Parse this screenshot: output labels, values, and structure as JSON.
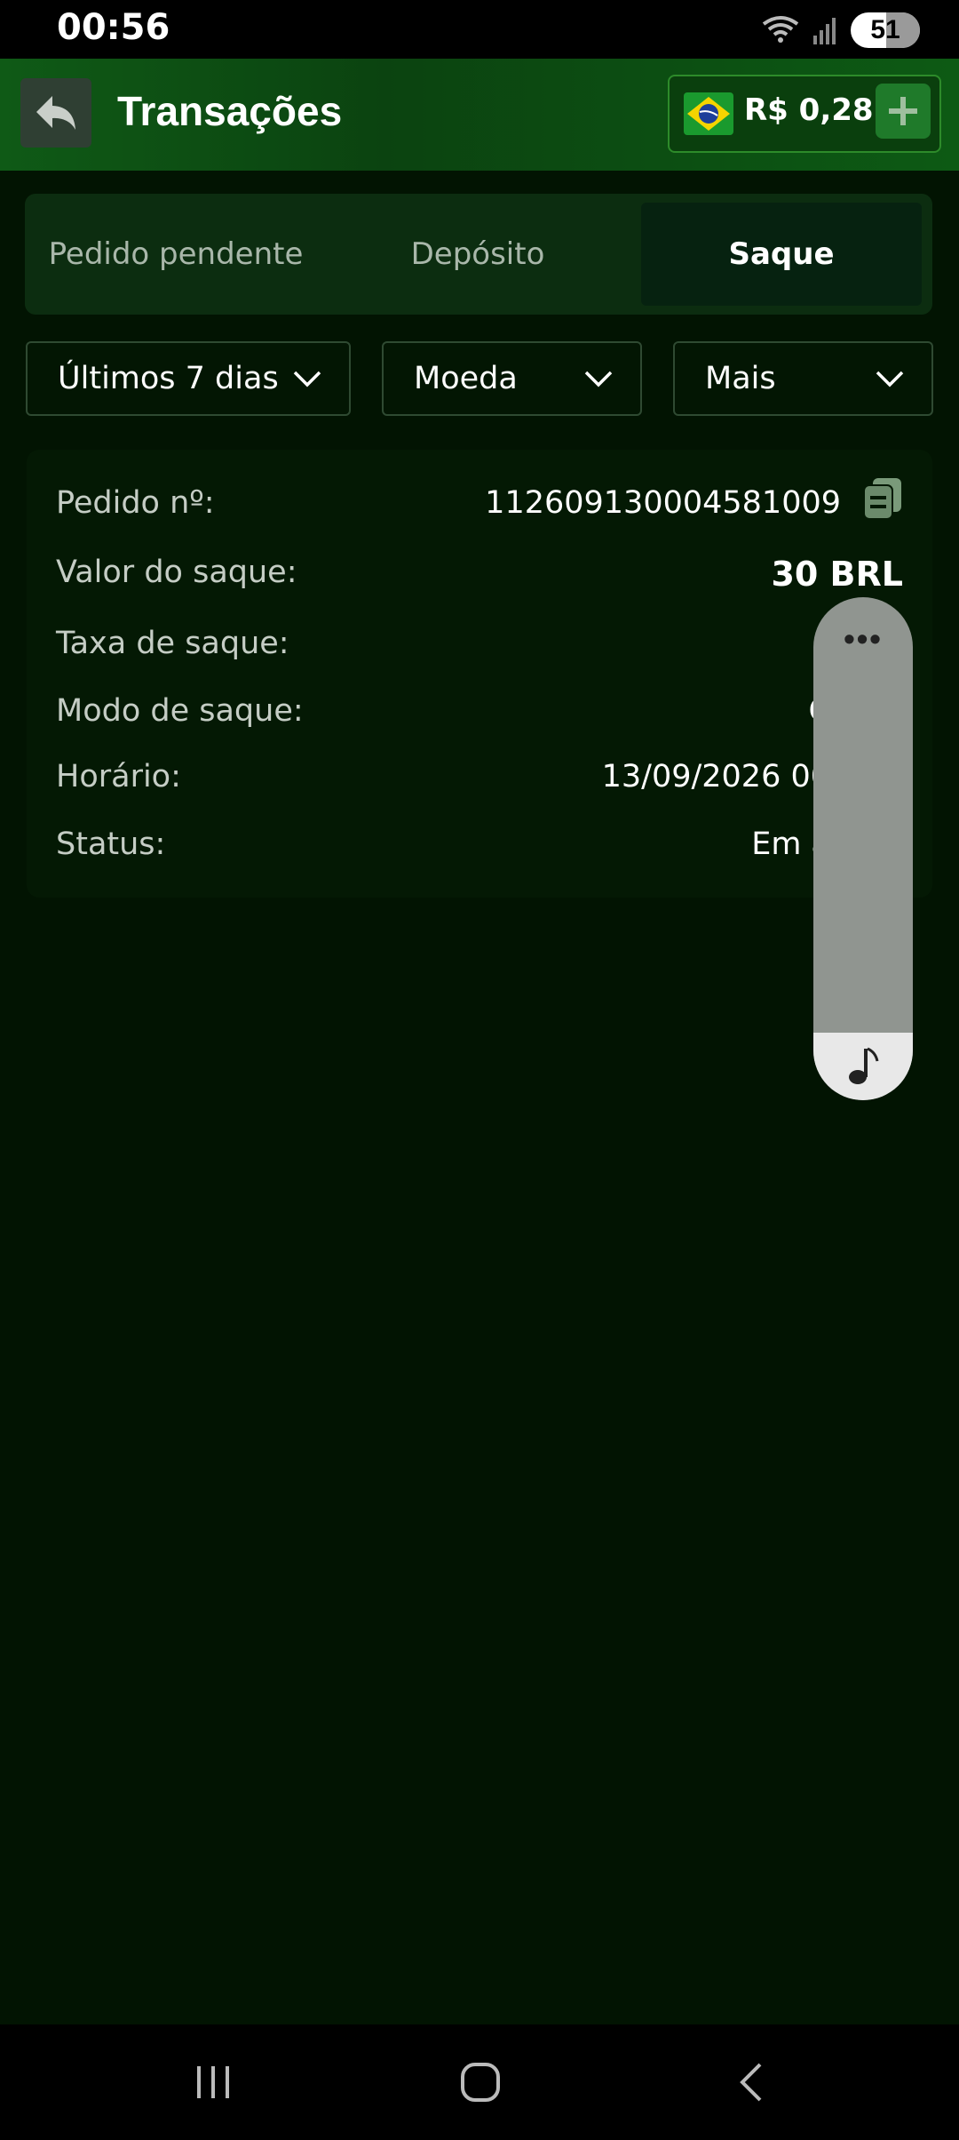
{
  "status_bar": {
    "time": "00:56",
    "battery": "51"
  },
  "header": {
    "title": "Transações",
    "balance": "R$ 0,28"
  },
  "tabs": [
    {
      "label": "Pedido pendente",
      "active": false
    },
    {
      "label": "Depósito",
      "active": false
    },
    {
      "label": "Saque",
      "active": true
    }
  ],
  "filters": {
    "period": "Últimos 7 dias",
    "currency": "Moeda",
    "more": "Mais"
  },
  "transaction": {
    "order_label": "Pedido nº:",
    "order_value": "112609130004581009",
    "amount_label": "Valor do saque:",
    "amount_value": "30 BRL",
    "fee_label": "Taxa de saque:",
    "mode_label": "Modo de saque:",
    "mode_value": "C",
    "time_label": "Horário:",
    "time_value": "13/09/2026 00",
    "status_label": "Status:",
    "status_value": "Em a"
  },
  "floating_widget": {
    "more": "•••"
  },
  "colors": {
    "background": "#021402",
    "accent": "#1f7a2a",
    "header": "#0b4310"
  }
}
